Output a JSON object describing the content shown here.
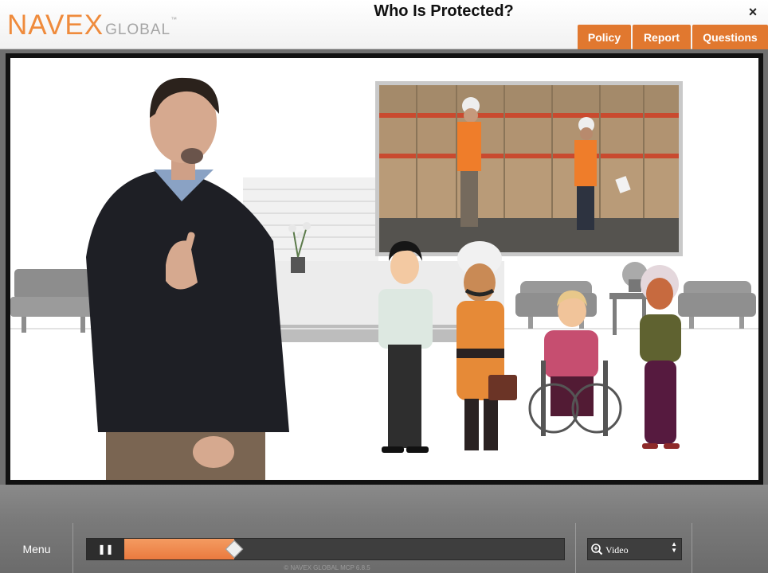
{
  "header": {
    "logo_main": "NAVEX",
    "logo_sub": "GLOBAL",
    "logo_tm": "™",
    "title": "Who Is Protected?",
    "close_glyph": "×",
    "tabs": [
      {
        "label": "Policy"
      },
      {
        "label": "Report"
      },
      {
        "label": "Questions"
      }
    ]
  },
  "player": {
    "menu_label": "Menu",
    "play_glyph": "❚❚",
    "progress_fraction": 0.25,
    "view_select": {
      "icon": "magnifier-icon",
      "value": "Video"
    },
    "copyright": "© NAVEX GLOBAL MCP 6.8.5"
  },
  "colors": {
    "brand_orange": "#e1782f",
    "logo_orange": "#ef8b3c",
    "progress_fill": "#f08c52"
  }
}
